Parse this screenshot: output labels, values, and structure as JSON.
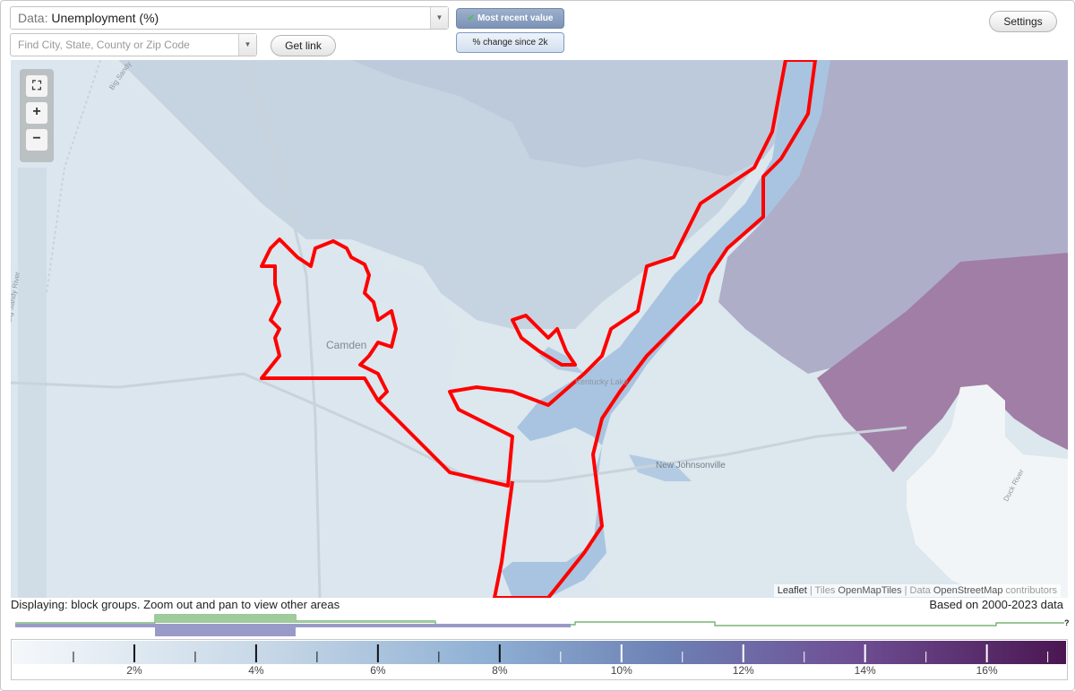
{
  "data_select": {
    "prefix": "Data:",
    "value": "Unemployment (%)"
  },
  "search": {
    "placeholder": "Find City, State, County or Zip Code"
  },
  "buttons": {
    "get_link": "Get link",
    "settings": "Settings"
  },
  "toggles": {
    "most_recent": "Most recent value",
    "pct_change": "% change since 2k"
  },
  "zoom": {
    "fullscreen_icon": "fullscreen-icon",
    "in": "+",
    "out": "−"
  },
  "map_labels": {
    "camden": "Camden",
    "kentucky_lake": "Kentucky Lake",
    "new_johnsonville": "New Johnsonville",
    "big_sandy_river": "Big Sandy River",
    "duck_river": "Duck River",
    "big_sandy_top": "Big Sandy"
  },
  "attribution": {
    "leaflet": "Leaflet",
    "sep1": " | Tiles ",
    "tiles": "OpenMapTiles",
    "sep2": " | Data ",
    "data": "OpenStreetMap",
    "contrib": " contributors"
  },
  "displaying": "Displaying: block groups. Zoom out and pan to view other areas",
  "based_on": "Based on 2000-2023 data",
  "histogram_help": "?",
  "legend": {
    "ticks": [
      "2%",
      "4%",
      "6%",
      "8%",
      "10%",
      "12%",
      "14%",
      "16%"
    ],
    "range": [
      0,
      17.3
    ],
    "colors": {
      "low": "#f5f8fb",
      "mid": "#8fb0d4",
      "high": "#4a1651"
    }
  },
  "colors": {
    "highlight": "#ff0000",
    "toggle_active": "#7d93b6"
  }
}
